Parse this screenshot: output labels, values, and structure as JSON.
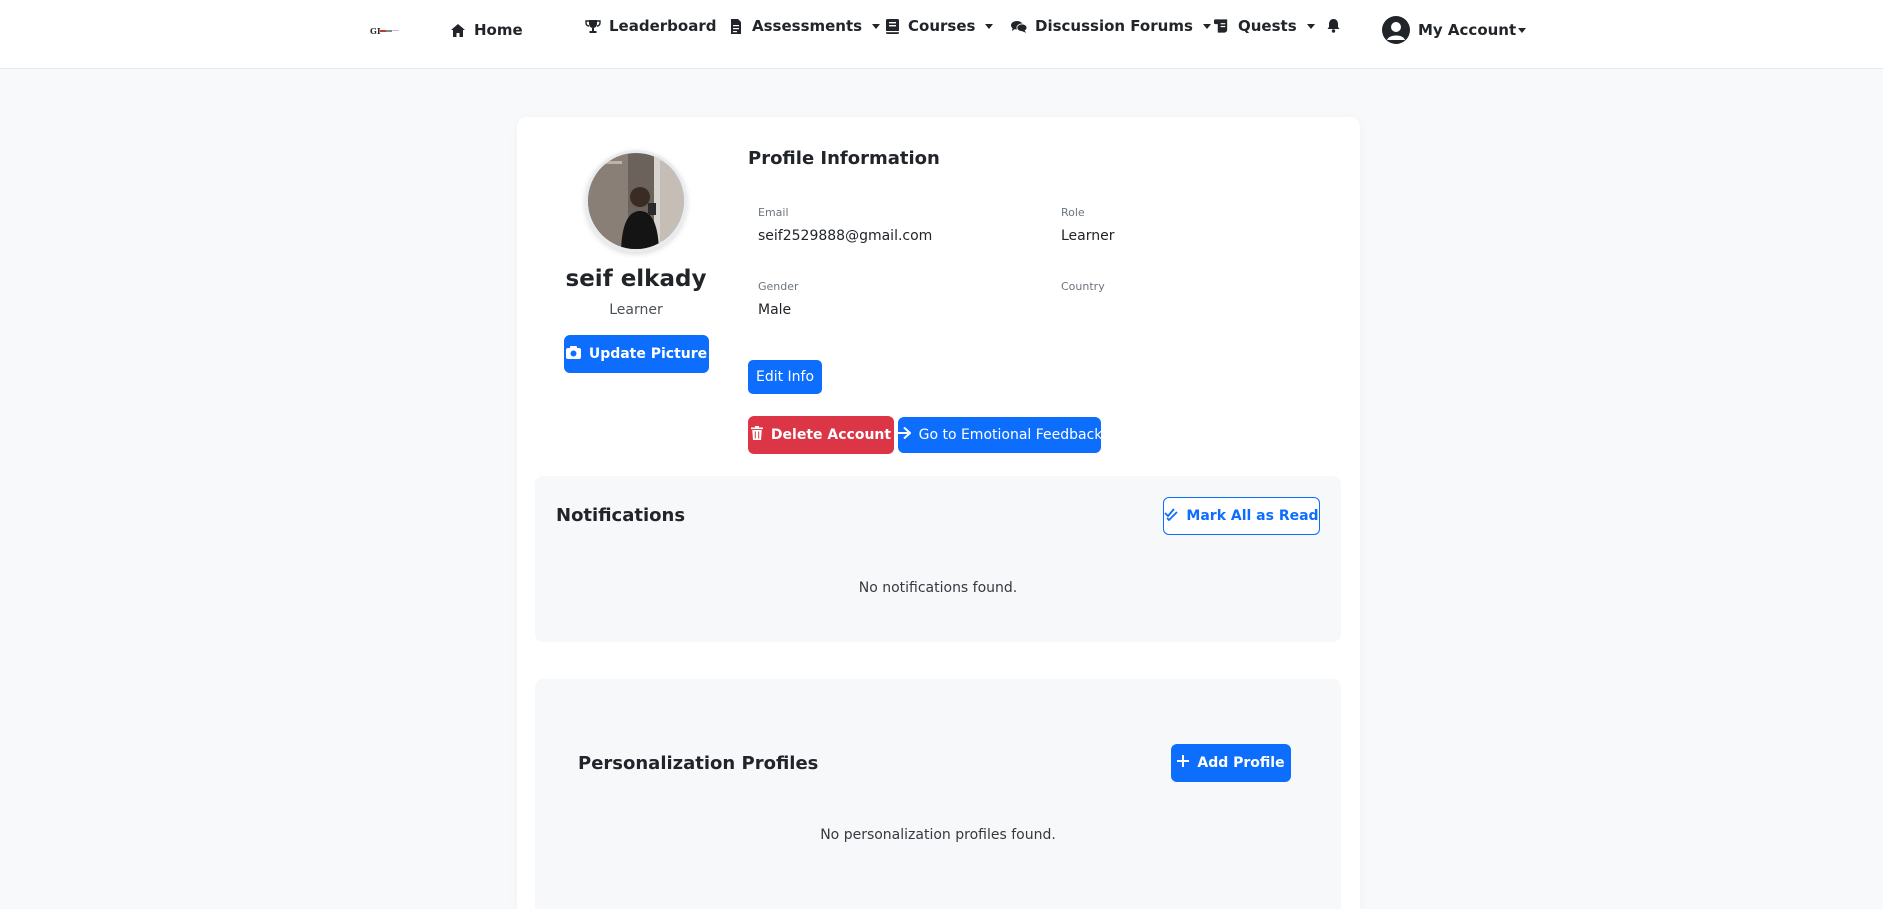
{
  "nav": {
    "home": "Home",
    "leaderboard": "Leaderboard",
    "assessments": "Assessments",
    "courses": "Courses",
    "discussion_forums": "Discussion Forums",
    "quests": "Quests",
    "my_account": "My Account"
  },
  "profile": {
    "name": "seif elkady",
    "role": "Learner",
    "update_picture_label": "Update Picture"
  },
  "info": {
    "title": "Profile Information",
    "email_label": "Email",
    "email_value": "seif2529888@gmail.com",
    "role_label": "Role",
    "role_value": "Learner",
    "gender_label": "Gender",
    "gender_value": "Male",
    "country_label": "Country",
    "country_value": "",
    "edit_label": "Edit Info",
    "delete_label": "Delete Account",
    "feedback_label": "Go to Emotional Feedback"
  },
  "notifications": {
    "title": "Notifications",
    "mark_all_label": "Mark All as Read",
    "empty_text": "No notifications found."
  },
  "personalization": {
    "title": "Personalization Profiles",
    "add_label": "Add Profile",
    "empty_text": "No personalization profiles found."
  },
  "colors": {
    "primary": "#0d6efd",
    "danger": "#dc3545",
    "background": "#f8f9fa",
    "panel": "#f7f8fa"
  }
}
